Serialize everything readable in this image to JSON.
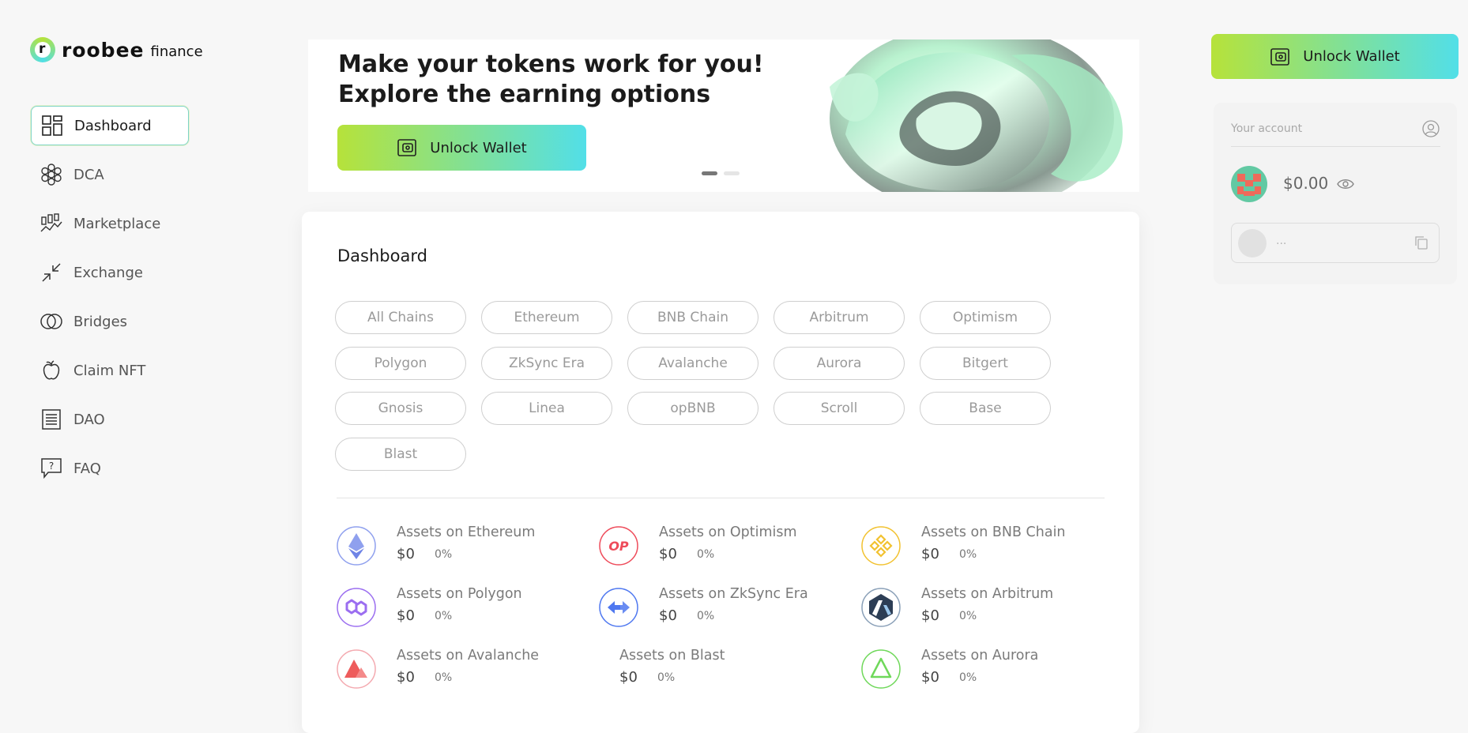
{
  "brand": {
    "mark": "r",
    "name": "roobee",
    "sub": "finance"
  },
  "nav": [
    {
      "id": "dashboard",
      "label": "Dashboard",
      "icon": "dashboard-grid-icon",
      "active": true
    },
    {
      "id": "dca",
      "label": "DCA",
      "icon": "flower-icon"
    },
    {
      "id": "marketplace",
      "label": "Marketplace",
      "icon": "marketplace-chart-icon"
    },
    {
      "id": "exchange",
      "label": "Exchange",
      "icon": "exchange-arrows-icon"
    },
    {
      "id": "bridges",
      "label": "Bridges",
      "icon": "bridges-rings-icon"
    },
    {
      "id": "claim-nft",
      "label": "Claim NFT",
      "icon": "apple-icon"
    },
    {
      "id": "dao",
      "label": "DAO",
      "icon": "document-icon"
    },
    {
      "id": "faq",
      "label": "FAQ",
      "icon": "question-bubble-icon"
    }
  ],
  "banner": {
    "line1": "Make your tokens work for you!",
    "line2": "Explore the earning options",
    "button": "Unlock Wallet",
    "slides": 2,
    "active_slide": 1
  },
  "dashboard": {
    "title": "Dashboard",
    "chains": [
      "All Chains",
      "Ethereum",
      "BNB Chain",
      "Arbitrum",
      "Optimism",
      "Polygon",
      "ZkSync Era",
      "Avalanche",
      "Aurora",
      "Bitgert",
      "Gnosis",
      "Linea",
      "opBNB",
      "Scroll",
      "Base",
      "Blast"
    ],
    "assets": [
      {
        "name": "Assets on Ethereum",
        "value": "$0",
        "pct": "0%",
        "icon": "ethereum-icon",
        "color": "#7b8ff0"
      },
      {
        "name": "Assets on Optimism",
        "value": "$0",
        "pct": "0%",
        "icon": "optimism-icon",
        "color": "#ee4b5a"
      },
      {
        "name": "Assets on BNB Chain",
        "value": "$0",
        "pct": "0%",
        "icon": "bnb-icon",
        "color": "#f2c230"
      },
      {
        "name": "Assets on Polygon",
        "value": "$0",
        "pct": "0%",
        "icon": "polygon-icon",
        "color": "#9b6ef0"
      },
      {
        "name": "Assets on ZkSync Era",
        "value": "$0",
        "pct": "0%",
        "icon": "zksync-icon",
        "color": "#4f78f0"
      },
      {
        "name": "Assets on Arbitrum",
        "value": "$0",
        "pct": "0%",
        "icon": "arbitrum-icon",
        "color": "#2d3e55"
      },
      {
        "name": "Assets on Avalanche",
        "value": "$0",
        "pct": "0%",
        "icon": "avalanche-icon",
        "color": "#ee5c5c"
      },
      {
        "name": "Assets on Blast",
        "value": "$0",
        "pct": "0%",
        "icon": "",
        "color": ""
      },
      {
        "name": "Assets on Aurora",
        "value": "$0",
        "pct": "0%",
        "icon": "aurora-icon",
        "color": "#6fd85a"
      }
    ]
  },
  "wallet_button": "Unlock Wallet",
  "account": {
    "label": "Your account",
    "balance": "$0.00",
    "address": "..."
  },
  "colors": {
    "gradient_start": "#b6e23a",
    "gradient_end": "#52dfe8"
  }
}
